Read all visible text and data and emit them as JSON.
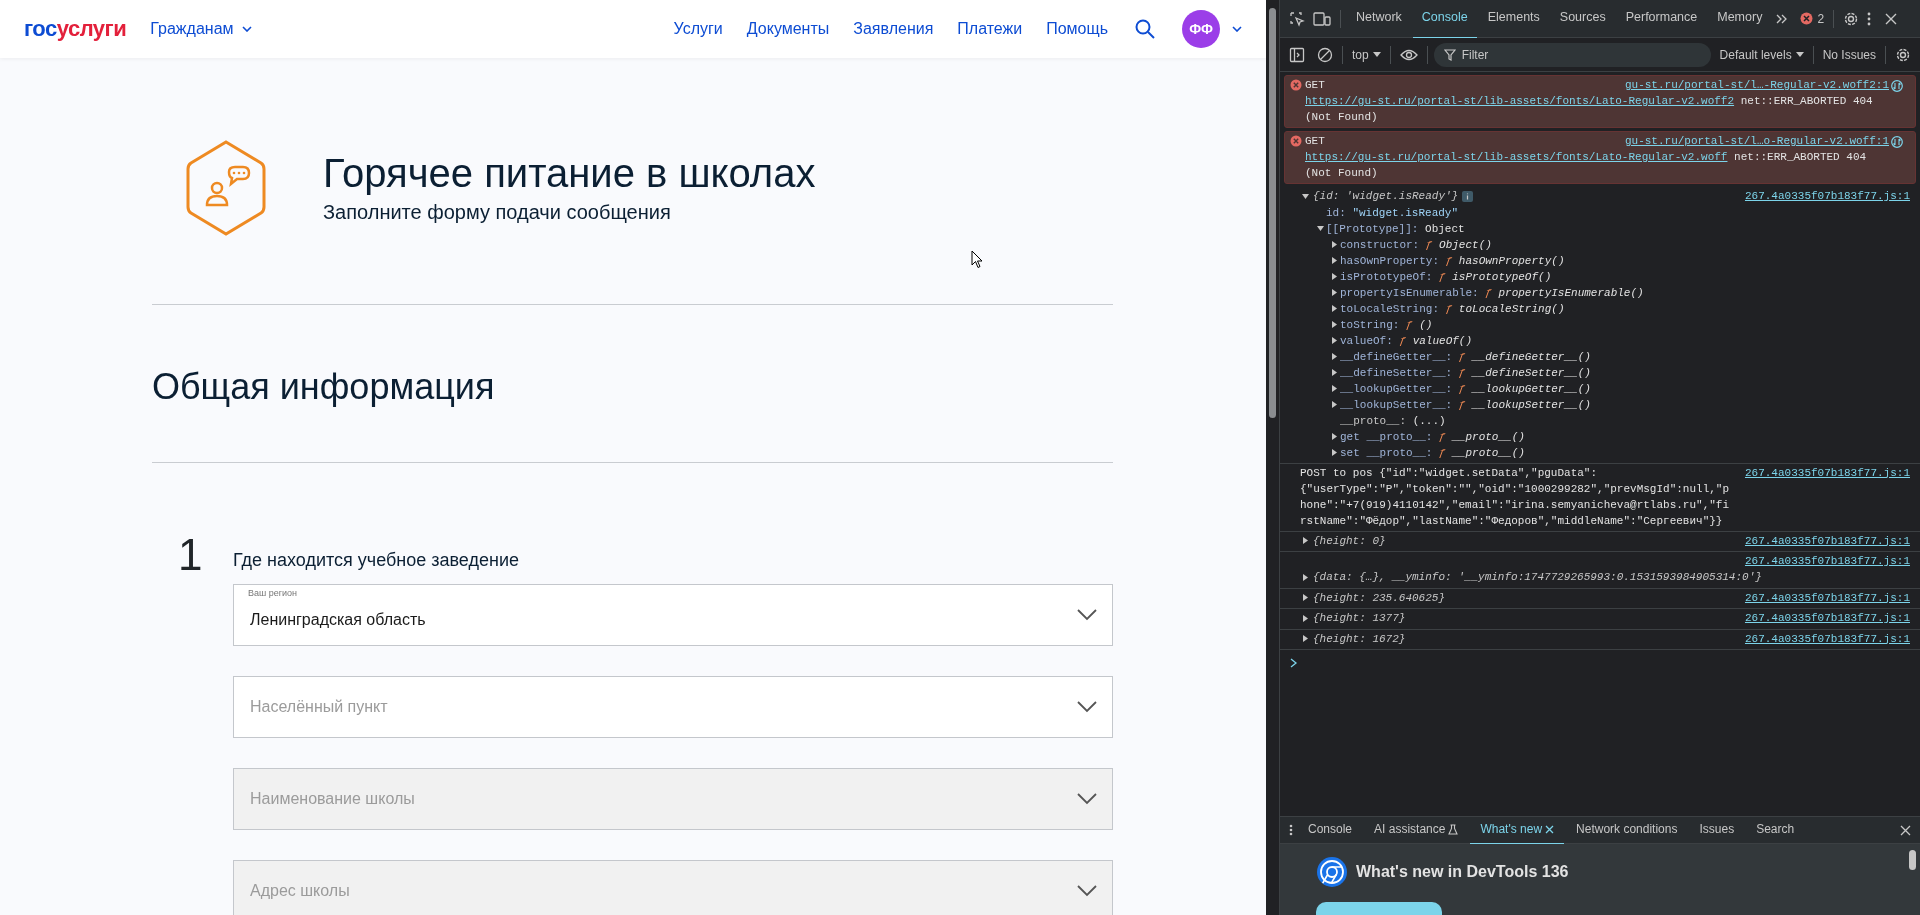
{
  "page": {
    "header": {
      "logo": {
        "part_1": "гос",
        "part_2": "услуги"
      },
      "audience_menu": "Гражданам",
      "nav": [
        "Услуги",
        "Документы",
        "Заявления",
        "Платежи",
        "Помощь"
      ],
      "avatar": "ФФ"
    },
    "service": {
      "title": "Горячее питание в школах",
      "subtitle": "Заполните форму подачи сообщения"
    },
    "section_title": "Общая информация",
    "step": {
      "number": "1",
      "title": "Где находится учебное заведение",
      "fields": [
        {
          "label": "Ваш регион",
          "value": "Ленинградская область",
          "disabled": false
        },
        {
          "placeholder": "Населённый пункт",
          "disabled": false
        },
        {
          "placeholder": "Наименование школы",
          "disabled": true
        },
        {
          "placeholder": "Адрес школы",
          "disabled": true
        }
      ]
    }
  },
  "devtools": {
    "tabs": [
      {
        "label": "Network",
        "selected": false
      },
      {
        "label": "Console",
        "selected": true
      },
      {
        "label": "Elements",
        "selected": false
      },
      {
        "label": "Sources",
        "selected": false
      },
      {
        "label": "Performance",
        "selected": false
      },
      {
        "label": "Memory",
        "selected": false
      }
    ],
    "error_count": "2",
    "toolbar": {
      "context": "top",
      "filter_placeholder": "Filter",
      "levels": "Default levels",
      "issues": "No Issues"
    },
    "messages": [
      {
        "kind": "error",
        "method": "GET",
        "source": "gu-st.ru/portal-st/l…-Regular-v2.woff2:1",
        "url": "https://gu-st.ru/portal-st/lib-assets/fonts/Lato-Regular-v2.woff2",
        "status": "net::ERR_ABORTED 404",
        "note": "(Not Found)"
      },
      {
        "kind": "error",
        "method": "GET",
        "source": "gu-st.ru/portal-st/l…o-Regular-v2.woff:1",
        "url": "https://gu-st.ru/portal-st/lib-assets/fonts/Lato-Regular-v2.woff",
        "status": "net::ERR_ABORTED 404",
        "note": "(Not Found)"
      },
      {
        "kind": "object",
        "summary": "{id: 'widget.isReady'}",
        "expanded": true,
        "source": "267.4a0335f07b183f77.js:1",
        "children": [
          {
            "kind": "property",
            "key": "id:",
            "value": "\"widget.isReady\""
          },
          {
            "kind": "node",
            "key": "[[Prototype]]:",
            "value": "Object",
            "expanded": true,
            "children": [
              {
                "kind": "node",
                "key": "constructor:",
                "fn": "ƒ",
                "value": "Object()",
                "expanded": false
              },
              {
                "kind": "node",
                "key": "hasOwnProperty:",
                "fn": "ƒ",
                "value": "hasOwnProperty()",
                "expanded": false
              },
              {
                "kind": "node",
                "key": "isPrototypeOf:",
                "fn": "ƒ",
                "value": "isPrototypeOf()",
                "expanded": false
              },
              {
                "kind": "node",
                "key": "propertyIsEnumerable:",
                "fn": "ƒ",
                "value": "propertyIsEnumerable()",
                "expanded": false
              },
              {
                "kind": "node",
                "key": "toLocaleString:",
                "fn": "ƒ",
                "value": "toLocaleString()",
                "expanded": false
              },
              {
                "kind": "node",
                "key": "toString:",
                "fn": "ƒ",
                "value": "()",
                "expanded": false
              },
              {
                "kind": "node",
                "key": "valueOf:",
                "fn": "ƒ",
                "value": "valueOf()",
                "expanded": false
              },
              {
                "kind": "node",
                "key": "__defineGetter__:",
                "fn": "ƒ",
                "value": "__defineGetter__()",
                "expanded": false
              },
              {
                "kind": "node",
                "key": "__defineSetter__:",
                "fn": "ƒ",
                "value": "__defineSetter__()",
                "expanded": false
              },
              {
                "kind": "node",
                "key": "__lookupGetter__:",
                "fn": "ƒ",
                "value": "__lookupGetter__()",
                "expanded": false
              },
              {
                "kind": "node",
                "key": "__lookupSetter__:",
                "fn": "ƒ",
                "value": "__lookupSetter__()",
                "expanded": false
              },
              {
                "kind": "getter",
                "key": "__proto__:",
                "value": "(...)"
              },
              {
                "kind": "node",
                "key": "get __proto__:",
                "fn": "ƒ",
                "value": "__proto__()",
                "expanded": false
              },
              {
                "kind": "node",
                "key": "set __proto__:",
                "fn": "ƒ",
                "value": "__proto__()",
                "expanded": false
              }
            ]
          }
        ]
      },
      {
        "kind": "log",
        "source": "267.4a0335f07b183f77.js:1",
        "text": "POST to pos {\"id\":\"widget.setData\",\"pguData\":{\"userType\":\"P\",\"token\":\"\",\"oid\":\"1000299282\",\"prevMsgId\":null,\"phone\":\"+7(919)4110142\",\"email\":\"irina.semyanicheva@rtlabs.ru\",\"firstName\":\"Фёдор\",\"lastName\":\"Федоров\",\"middleName\":\"Сергеевич\"}}"
      },
      {
        "kind": "object",
        "summary": "{height: 0}",
        "expanded": false,
        "source": "267.4a0335f07b183f77.js:1"
      },
      {
        "kind": "object",
        "summary": "{data: {…}, __yminfo: '__yminfo:1747729265993:0.1531593984905314:0'}",
        "expanded": false,
        "source": "267.4a0335f07b183f77.js:1"
      },
      {
        "kind": "object",
        "summary": "{height: 235.640625}",
        "expanded": false,
        "source": "267.4a0335f07b183f77.js:1"
      },
      {
        "kind": "object",
        "summary": "{height: 1377}",
        "expanded": false,
        "source": "267.4a0335f07b183f77.js:1"
      },
      {
        "kind": "object",
        "summary": "{height: 1672}",
        "expanded": false,
        "source": "267.4a0335f07b183f77.js:1"
      }
    ],
    "drawer": {
      "tabs": [
        {
          "label": "Console",
          "kind": "plain",
          "selected": false
        },
        {
          "label": "AI assistance",
          "kind": "experiment",
          "selected": false
        },
        {
          "label": "What's new",
          "kind": "closable",
          "selected": true
        },
        {
          "label": "Network conditions",
          "kind": "plain",
          "selected": false
        },
        {
          "label": "Issues",
          "kind": "plain",
          "selected": false
        },
        {
          "label": "Search",
          "kind": "plain",
          "selected": false
        }
      ],
      "whats_new_title": "What's new in DevTools 136"
    }
  }
}
